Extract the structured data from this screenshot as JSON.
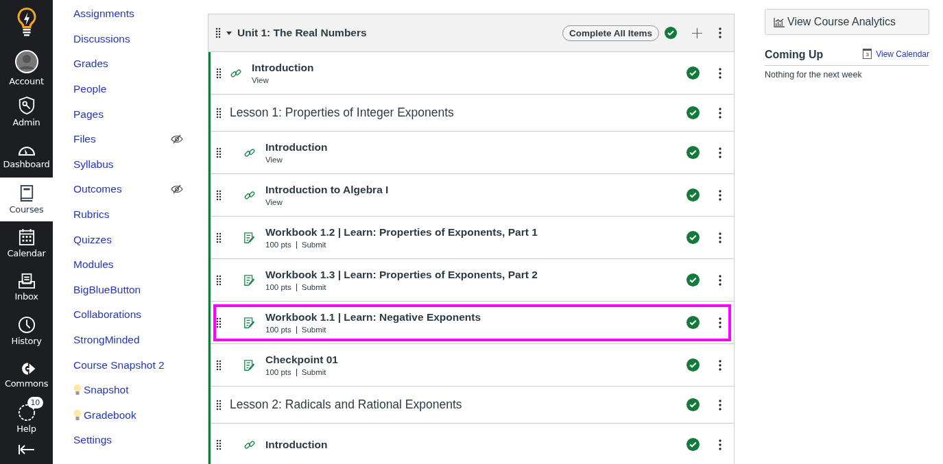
{
  "global_nav": [
    {
      "label": "Account",
      "selected": false
    },
    {
      "label": "Admin",
      "selected": false
    },
    {
      "label": "Dashboard",
      "selected": false
    },
    {
      "label": "Courses",
      "selected": true
    },
    {
      "label": "Calendar",
      "selected": false
    },
    {
      "label": "Inbox",
      "selected": false
    },
    {
      "label": "History",
      "selected": false
    },
    {
      "label": "Commons",
      "selected": false
    },
    {
      "label": "Help",
      "selected": false,
      "badge": "10"
    }
  ],
  "course_nav": [
    {
      "label": "Assignments",
      "hidden": false,
      "bulb": false
    },
    {
      "label": "Discussions",
      "hidden": false,
      "bulb": false
    },
    {
      "label": "Grades",
      "hidden": false,
      "bulb": false
    },
    {
      "label": "People",
      "hidden": false,
      "bulb": false
    },
    {
      "label": "Pages",
      "hidden": false,
      "bulb": false
    },
    {
      "label": "Files",
      "hidden": true,
      "bulb": false
    },
    {
      "label": "Syllabus",
      "hidden": false,
      "bulb": false
    },
    {
      "label": "Outcomes",
      "hidden": true,
      "bulb": false
    },
    {
      "label": "Rubrics",
      "hidden": false,
      "bulb": false
    },
    {
      "label": "Quizzes",
      "hidden": false,
      "bulb": false
    },
    {
      "label": "Modules",
      "hidden": false,
      "bulb": false
    },
    {
      "label": "BigBlueButton",
      "hidden": false,
      "bulb": false
    },
    {
      "label": "Collaborations",
      "hidden": false,
      "bulb": false
    },
    {
      "label": "StrongMinded",
      "hidden": false,
      "bulb": false
    },
    {
      "label": "Course Snapshot 2",
      "hidden": false,
      "bulb": false
    },
    {
      "label": "Snapshot",
      "hidden": false,
      "bulb": true
    },
    {
      "label": "Gradebook",
      "hidden": false,
      "bulb": true
    },
    {
      "label": "Settings",
      "hidden": false,
      "bulb": false
    }
  ],
  "module": {
    "title": "Unit 1: The Real Numbers",
    "expanded": true,
    "complete_button": "Complete All Items",
    "completed": true,
    "items": [
      {
        "kind": "link",
        "title": "Introduction",
        "meta": [
          "View"
        ],
        "completed": true,
        "highlighted": false
      },
      {
        "kind": "subheader",
        "title": "Lesson 1: Properties of Integer Exponents",
        "completed": true,
        "highlighted": false,
        "children": [
          {
            "kind": "link",
            "title": "Introduction",
            "meta": [
              "View"
            ],
            "completed": true,
            "highlighted": false
          },
          {
            "kind": "link",
            "title": "Introduction to Algebra I",
            "meta": [
              "View"
            ],
            "completed": true,
            "highlighted": false
          },
          {
            "kind": "assignment",
            "title": "Workbook 1.2 | Learn: Properties of Exponents, Part 1",
            "meta": [
              "100 pts",
              "Submit"
            ],
            "completed": true,
            "highlighted": false
          },
          {
            "kind": "assignment",
            "title": "Workbook 1.3 | Learn: Properties of Exponents, Part 2",
            "meta": [
              "100 pts",
              "Submit"
            ],
            "completed": true,
            "highlighted": false
          },
          {
            "kind": "assignment",
            "title": "Workbook 1.1 | Learn: Negative Exponents",
            "meta": [
              "100 pts",
              "Submit"
            ],
            "completed": true,
            "highlighted": true
          },
          {
            "kind": "assignment",
            "title": "Checkpoint 01",
            "meta": [
              "100 pts",
              "Submit"
            ],
            "completed": true,
            "highlighted": false
          }
        ]
      },
      {
        "kind": "subheader",
        "title": "Lesson 2: Radicals and Rational Exponents",
        "completed": true,
        "highlighted": false,
        "children": [
          {
            "kind": "link",
            "title": "Introduction",
            "completed": true,
            "highlighted": false
          }
        ]
      }
    ]
  },
  "sidebar": {
    "analytics_button": "View Course Analytics",
    "coming_up": {
      "title": "Coming Up",
      "calendar_link": "View Calendar",
      "calendar_day": "3",
      "empty_text": "Nothing for the next week"
    }
  }
}
